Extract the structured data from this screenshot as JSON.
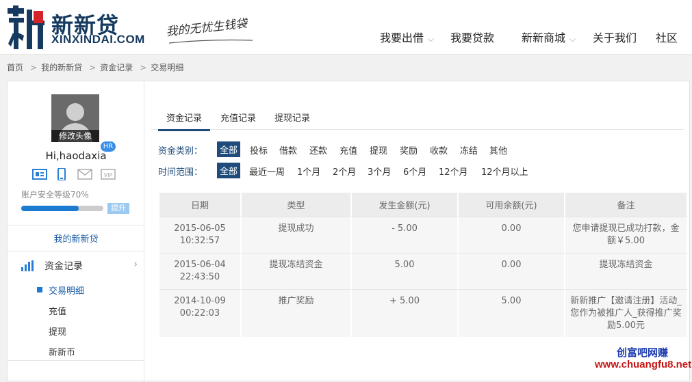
{
  "brand": {
    "name_cn": "新新贷",
    "name_en": "XINXINDAI.COM",
    "slogan": "我的无忧生钱袋"
  },
  "nav": {
    "items": [
      {
        "label": "我要出借",
        "has_menu": true
      },
      {
        "label": "我要贷款",
        "has_menu": false
      },
      {
        "label": "新新商城",
        "has_menu": true
      },
      {
        "label": "关于我们",
        "has_menu": false
      },
      {
        "label": "社区",
        "has_menu": false
      }
    ]
  },
  "breadcrumb": [
    "首页",
    "我的新新贷",
    "资金记录",
    "交易明细"
  ],
  "user": {
    "avatar_caption": "修改头像",
    "greeting": "Hi,haodaxia",
    "level_badge": "HR",
    "security_text": "账户安全等级70%",
    "security_level": 0.7,
    "upgrade_label": "提升",
    "verify_icons": [
      "id-card-icon",
      "phone-icon",
      "email-icon",
      "vip-icon"
    ]
  },
  "sidebar": {
    "my_link": "我的新新贷",
    "group_label": "资金记录",
    "sub_items": [
      "交易明细",
      "充值",
      "提现",
      "新新币"
    ]
  },
  "tabs": [
    "资金记录",
    "充值记录",
    "提现记录"
  ],
  "filters": {
    "type_label": "资金类别：",
    "type_options": [
      "全部",
      "投标",
      "借款",
      "还款",
      "充值",
      "提现",
      "奖励",
      "收款",
      "冻结",
      "其他"
    ],
    "time_label": "时间范围：",
    "time_options": [
      "全部",
      "最近一周",
      "1个月",
      "2个月",
      "3个月",
      "6个月",
      "12个月",
      "12个月以上"
    ]
  },
  "table": {
    "headers": [
      "日期",
      "类型",
      "发生金额(元)",
      "可用余额(元)",
      "备注"
    ],
    "rows": [
      {
        "date": "2015-06-05",
        "time": "10:32:57",
        "type": "提现成功",
        "amount": "- 5.00",
        "balance": "0.00",
        "note1": "您申请提现已成功打款，金",
        "note2": "额￥5.00",
        "note3": ""
      },
      {
        "date": "2015-06-04",
        "time": "22:43:50",
        "type": "提现冻结资金",
        "amount": "5.00",
        "balance": "0.00",
        "note1": "提现冻结资金",
        "note2": "",
        "note3": ""
      },
      {
        "date": "2014-10-09",
        "time": "00:22:03",
        "type": "推广奖励",
        "amount": "+ 5.00",
        "balance": "5.00",
        "note1": "新新推广【邀请注册】活动_",
        "note2": "您作为被推广人_获得推广奖",
        "note3": "励5.00元"
      }
    ]
  },
  "watermark": {
    "line1": "创富吧网赚",
    "line2": "www.chuangfu8.net"
  },
  "colors": {
    "brand_navy": "#16395f",
    "accent_blue": "#1f4b7a",
    "link_blue": "#1f5ea8",
    "progress_blue": "#1b7bd0"
  }
}
